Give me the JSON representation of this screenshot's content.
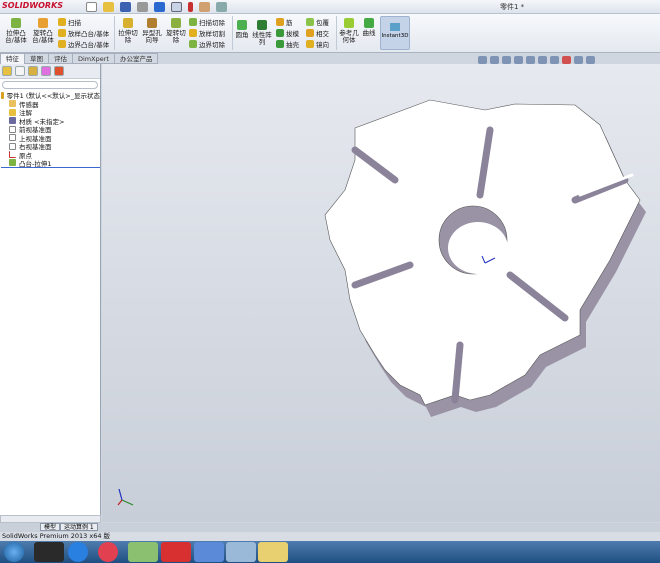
{
  "app": {
    "logo": "SOLIDWORKS",
    "document_title": "零件1 *"
  },
  "ribbon": {
    "large": [
      {
        "label": "拉伸凸台/基体"
      },
      {
        "label": "旋转凸台/基体"
      },
      {
        "label": "拉伸切除"
      },
      {
        "label": "异型孔向导"
      },
      {
        "label": "旋转切除"
      },
      {
        "label": "圆角"
      },
      {
        "label": "线性阵列"
      },
      {
        "label": "参考几何体"
      },
      {
        "label": "曲线"
      }
    ],
    "small": [
      {
        "label": "扫描"
      },
      {
        "label": "放样凸台/基体"
      },
      {
        "label": "边界凸台/基体"
      },
      {
        "label": "扫描切除"
      },
      {
        "label": "放样切割"
      },
      {
        "label": "边界切除"
      },
      {
        "label": "筋"
      },
      {
        "label": "拔模"
      },
      {
        "label": "抽壳"
      },
      {
        "label": "包覆"
      },
      {
        "label": "相交"
      },
      {
        "label": "镜向"
      }
    ],
    "instant3d": "Instant3D"
  },
  "tabs": [
    {
      "label": "特征",
      "active": true
    },
    {
      "label": "草图"
    },
    {
      "label": "评估"
    },
    {
      "label": "DimXpert"
    },
    {
      "label": "办公室产品"
    }
  ],
  "tree": [
    {
      "label": "零件1 (默认<<默认>_显示状态"
    },
    {
      "label": "传感器"
    },
    {
      "label": "注解"
    },
    {
      "label": "材质 <未指定>"
    },
    {
      "label": "前视基准面"
    },
    {
      "label": "上视基准面"
    },
    {
      "label": "右视基准面"
    },
    {
      "label": "原点"
    },
    {
      "label": "凸台-拉伸1"
    }
  ],
  "bottom_tabs": [
    {
      "label": "模型"
    },
    {
      "label": "运动算例 1"
    }
  ],
  "status": "SolidWorks Premium 2013 x64 版",
  "colors": {
    "accent": "#c8102e",
    "viewport": "#d5dae2",
    "part_face": "#ffffff",
    "part_side": "#9a93a6"
  }
}
